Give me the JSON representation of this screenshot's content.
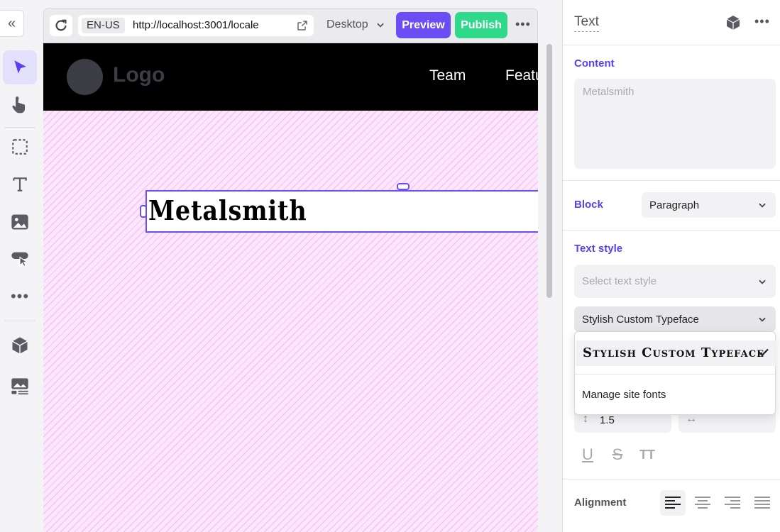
{
  "browser": {
    "locale": "EN-US",
    "url": "http://localhost:3001/locale",
    "device": "Desktop",
    "preview_label": "Preview",
    "publish_label": "Publish"
  },
  "site": {
    "logo_text": "Logo",
    "nav": [
      "Team",
      "Featu"
    ]
  },
  "selected_text": "Metalsmith",
  "panel": {
    "title": "Text",
    "content_label": "Content",
    "content_placeholder": "Metalsmith",
    "block_label": "Block",
    "block_value": "Paragraph",
    "text_style_label": "Text style",
    "text_style_placeholder": "Select text style",
    "font_value": "Stylish Custom Typeface",
    "font_options": [
      {
        "label": "Stylish Custom Typeface",
        "selected": true
      }
    ],
    "manage_fonts_label": "Manage site fonts",
    "line_height": "1.5",
    "alignment_label": "Alignment",
    "alignment_active": "left"
  },
  "colors": {
    "accent": "#6a4df5",
    "publish": "#2ed98a",
    "canvas_bg": "#fbe6fb"
  },
  "icons": {
    "toolbar": [
      "select-arrow-icon",
      "hand-icon",
      "marquee-icon",
      "text-tool-icon",
      "image-tool-icon",
      "hover-cursor-icon",
      "more-icon",
      "component-icon",
      "media-icon"
    ]
  }
}
